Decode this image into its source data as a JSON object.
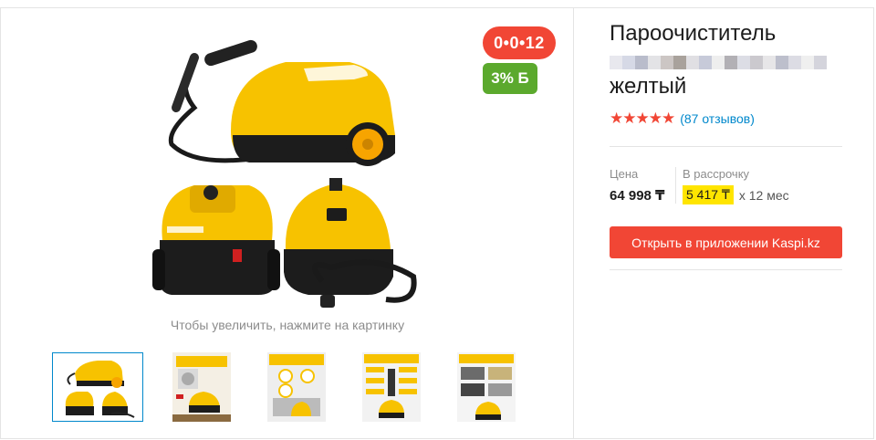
{
  "gallery": {
    "badge_installment": "0•0•12",
    "badge_bonus": "3% Б",
    "zoom_hint": "Чтобы увеличить, нажмите на картинку",
    "main_image": "steam-cleaner-product-photo",
    "thumbnails": [
      {
        "name": "thumb-product-photo",
        "active": true
      },
      {
        "name": "thumb-infographic-1",
        "active": false
      },
      {
        "name": "thumb-infographic-2",
        "active": false
      },
      {
        "name": "thumb-infographic-3",
        "active": false
      },
      {
        "name": "thumb-infographic-4",
        "active": false
      }
    ]
  },
  "product": {
    "title_line1": "Пароочиститель",
    "title_line3": "желтый",
    "stars": "★★★★★",
    "reviews": "(87 отзывов)"
  },
  "pricing": {
    "price_label": "Цена",
    "price_value": "64 998 ₸",
    "installment_label": "В рассрочку",
    "installment_amount": "5 417 ₸",
    "installment_term": "х 12 мес"
  },
  "actions": {
    "open_app_label": "Открыть в приложении Kaspi.kz"
  },
  "colors": {
    "brand_red": "#f14635",
    "bonus_green": "#5ba92d",
    "link_blue": "#0088cc",
    "highlight_yellow": "#ffe500",
    "product_yellow": "#f7c200"
  }
}
